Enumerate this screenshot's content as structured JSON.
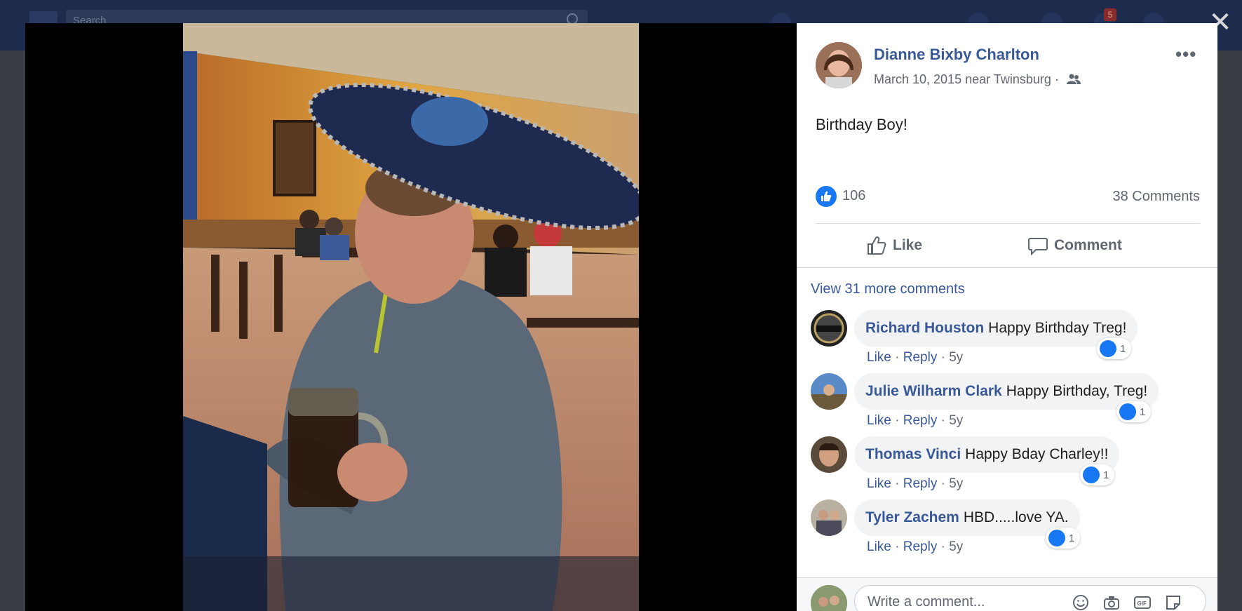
{
  "background": {
    "search_placeholder": "Search",
    "notification_count": "5"
  },
  "close_symbol": "✕",
  "post": {
    "author": "Dianne Bixby Charlton",
    "date": "March 10, 2015",
    "location_prefix": "near",
    "location": "Twinsburg",
    "audience_icon": "friends-icon",
    "caption": "Birthday Boy!",
    "like_count": "106",
    "comments_count": "38 Comments",
    "more_symbol": "•••"
  },
  "actions": {
    "like_label": "Like",
    "comment_label": "Comment"
  },
  "comments_section": {
    "view_more": "View 31 more comments",
    "action_like": "Like",
    "action_reply": "Reply",
    "separator": "·",
    "items": [
      {
        "name": "Richard Houston",
        "text": "Happy Birthday Treg!",
        "age": "5y",
        "reactions": "1"
      },
      {
        "name": "Julie Wilharm Clark",
        "text": "Happy Birthday, Treg!",
        "age": "5y",
        "reactions": "1"
      },
      {
        "name": "Thomas Vinci",
        "text": "Happy Bday Charley!!",
        "age": "5y",
        "reactions": "1"
      },
      {
        "name": "Tyler Zachem",
        "text": "HBD.....love YA.",
        "age": "5y",
        "reactions": "1"
      }
    ]
  },
  "composer": {
    "placeholder": "Write a comment..."
  },
  "colors": {
    "link_blue": "#385898",
    "like_blue": "#1877f2",
    "text_gray": "#606770"
  }
}
